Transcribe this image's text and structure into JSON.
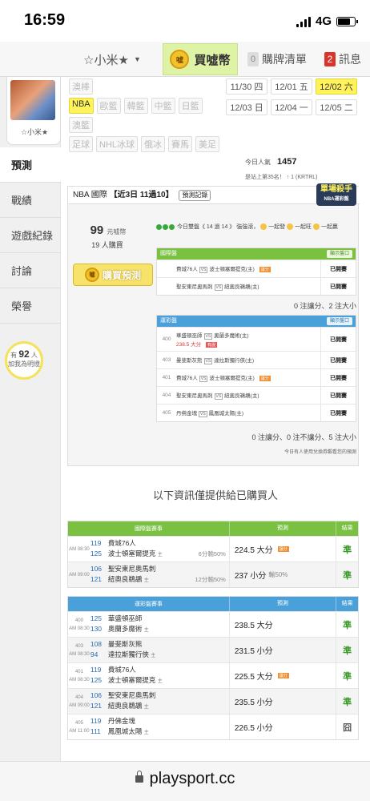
{
  "status_bar": {
    "time": "16:59",
    "network": "4G"
  },
  "top_nav": {
    "username": "☆小米★",
    "buy_label": "買噓幣",
    "coin_glyph": "噓",
    "cart_count": "0",
    "cart_label": "購牌清單",
    "msg_count": "2",
    "msg_label": "訊息"
  },
  "sidebar": {
    "avatar_name": "☆小米★",
    "items": [
      "預測",
      "戰績",
      "遊戲紀錄",
      "討論",
      "榮譽"
    ],
    "fans_prefix": "有",
    "fans_count": "92",
    "fans_unit": "人",
    "fans_text": "加我為明燈"
  },
  "leagues": {
    "row1": [
      "澳棒"
    ],
    "row2": [
      "NBA",
      "歐籃",
      "韓籃",
      "中籃",
      "日籃"
    ],
    "row3": [
      "澳籃"
    ],
    "row4": [
      "足球",
      "NHL冰球",
      "俄冰",
      "賽馬",
      "美足"
    ]
  },
  "dates": {
    "row1": [
      "11/30 四",
      "12/01 五",
      "12/02 六"
    ],
    "row2": [
      "12/03 日",
      "12/04 一",
      "12/05 二"
    ]
  },
  "stats": {
    "popularity_label": "今日人氣",
    "popularity": "1457",
    "rank_text": "是站上第35名！ ↑ 1 (KRTRL)"
  },
  "prediction": {
    "league": "NBA 國際",
    "record": "【近3日 11過10】",
    "record_btn": "預測記錄",
    "killer_title": "單場殺手",
    "killer_sub": "NBA運彩盤",
    "price": "99",
    "price_unit": "元噓幣",
    "buyers": "19 人購買",
    "buy_btn": "購買預測",
    "streak_text": "今日雙盤《 14 過 14 》 強強滾，",
    "streak_e1": "一起發",
    "streak_e2": "一起旺",
    "streak_e3": "一起贏",
    "intl": {
      "title": "國際盤",
      "show_btn": "顯示盤口",
      "rows": [
        {
          "match_a": "費城76人",
          "match_b": "波士頓塞爾提克(主)",
          "tag": "讓分",
          "status": "已開賽"
        },
        {
          "match_a": "聖安東尼奧馬刺",
          "match_b": "紐奧良鵜鶘(主)",
          "tag": "",
          "status": "已開賽"
        }
      ],
      "summary": "0 注讓分、2 注大小"
    },
    "sport": {
      "title": "運彩盤",
      "show_btn": "顯示盤口",
      "rows": [
        {
          "no": "400",
          "match_a": "華盛頓巫師",
          "match_b": "奧蘭多魔術(主)",
          "extra": "238.5 大分",
          "tag": "有說",
          "status": "已開賽"
        },
        {
          "no": "403",
          "match_a": "曼斐斯灰熊",
          "match_b": "達拉斯獨行俠(主)",
          "extra": "",
          "tag": "",
          "status": "已開賽"
        },
        {
          "no": "401",
          "match_a": "費城76人",
          "match_b": "波士頓塞爾提克(主)",
          "extra": "",
          "tag": "讓分",
          "status": "已開賽"
        },
        {
          "no": "404",
          "match_a": "聖安東尼奧馬刺",
          "match_b": "紐奧良鵜鶘(主)",
          "extra": "",
          "tag": "",
          "status": "已開賽"
        },
        {
          "no": "405",
          "match_a": "丹佛金塊",
          "match_b": "鳳凰城太陽(主)",
          "extra": "",
          "tag": "",
          "status": "已開賽"
        }
      ],
      "summary": "0 注讓分、0 注不讓分、5 注大小"
    },
    "note": "今日有人使用兌換券觀看您的預測"
  },
  "info_title": "以下資訊僅提供給已購買人",
  "results_intl": {
    "head_game": "國際盤賽事",
    "head_pred": "預測",
    "head_res": "結果",
    "rows": [
      {
        "ampm": "AM 08:30",
        "t1n": "119",
        "t1": "費城76人",
        "t2n": "125",
        "t2": "波士頓塞爾提克",
        "spread": "6分輸50%",
        "pred": "224.5 大分",
        "sub": "讓分",
        "result": "準"
      },
      {
        "ampm": "AM 09:00",
        "t1n": "106",
        "t1": "聖安東尼奧馬刺",
        "t2n": "121",
        "t2": "紐奧良鵜鶘",
        "spread": "12分輸50%",
        "pred": "237 小分",
        "sub": "輸50%",
        "result": "準"
      }
    ]
  },
  "results_sport": {
    "head_game": "運彩盤賽事",
    "head_pred": "預測",
    "head_res": "結果",
    "rows": [
      {
        "no": "400",
        "ampm": "AM 08:30",
        "t1n": "125",
        "t1": "華盛頓巫師",
        "t2n": "130",
        "t2": "奧蘭多魔術",
        "pred": "238.5 大分",
        "result": "準"
      },
      {
        "no": "403",
        "ampm": "AM 08:30",
        "t1n": "108",
        "t1": "曼斐斯灰熊",
        "t2n": "94",
        "t2": "達拉斯獨行俠",
        "pred": "231.5 小分",
        "result": "準"
      },
      {
        "no": "401",
        "ampm": "AM 08:30",
        "t1n": "119",
        "t1": "費城76人",
        "t2n": "125",
        "t2": "波士頓塞爾提克",
        "pred": "225.5 大分",
        "result": "準"
      },
      {
        "no": "404",
        "ampm": "AM 09:00",
        "t1n": "106",
        "t1": "聖安東尼奧馬刺",
        "t2n": "121",
        "t2": "紐奧良鵜鶘",
        "pred": "235.5 小分",
        "result": "準"
      },
      {
        "no": "405",
        "ampm": "AM 11:00",
        "t1n": "119",
        "t1": "丹佛金塊",
        "t2n": "111",
        "t2": "鳳凰城太陽",
        "pred": "226.5 小分",
        "result": "囧"
      }
    ]
  },
  "home_mark": "主",
  "url": "playsport.cc"
}
